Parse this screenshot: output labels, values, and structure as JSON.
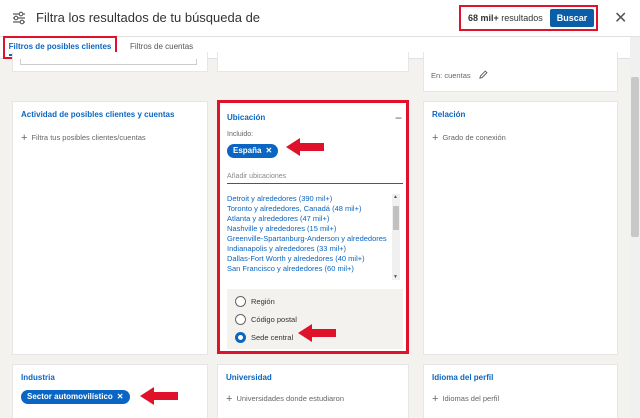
{
  "header": {
    "title": "Filtra los resultados de tu búsqueda de",
    "results_count": "68 mil+",
    "results_label": " resultados",
    "search_label": "Buscar",
    "close": "✕"
  },
  "tabs": [
    {
      "label": "Filtros de posibles clientes"
    },
    {
      "label": "Filtros de cuentas"
    }
  ],
  "top_right_card": {
    "text": "En: cuentas"
  },
  "activity_card": {
    "title": "Actividad de posibles clientes y cuentas",
    "action": "Filtra tus posibles clientes/cuentas"
  },
  "location_card": {
    "title": "Ubicación",
    "collapse": "−",
    "included_label": "Incluido:",
    "included_pill": "España",
    "add_label": "Añadir ubicaciones",
    "options": [
      "Detroit y alrededores (390 mil+)",
      "Toronto y alrededores, Canadá (48 mil+)",
      "Atlanta y alrededores (47 mil+)",
      "Nashville y alrededores (15 mil+)",
      "Greenville-Spartanburg-Anderson y alrededores",
      "Indianapolis y alrededores (33 mil+)",
      "Dallas-Fort Worth y alrededores (40 mil+)",
      "San Francisco y alrededores (60 mil+)"
    ],
    "radios": [
      {
        "label": "Región",
        "selected": false
      },
      {
        "label": "Código postal",
        "selected": false
      },
      {
        "label": "Sede central",
        "selected": true
      }
    ]
  },
  "relation_card": {
    "title": "Relación",
    "action": "Grado de conexión"
  },
  "industry_card": {
    "title": "Industria",
    "pill": "Sector automovilístico"
  },
  "university_card": {
    "title": "Universidad",
    "action": "Universidades donde estudiaron"
  },
  "language_card": {
    "title": "Idioma del perfil",
    "action": "Idiomas del perfil"
  },
  "colors": {
    "accent": "#0a66c2",
    "highlight": "#e0112a",
    "search_button": "#0a5ea8"
  }
}
